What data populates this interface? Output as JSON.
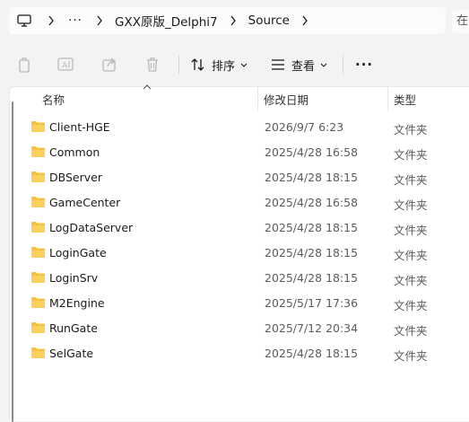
{
  "address_bar": {
    "ellipsis": "···",
    "crumbs": [
      "GXX原版_Delphi7",
      "Source"
    ],
    "right_edge_text": "在"
  },
  "toolbar": {
    "sort_label": "排序",
    "view_label": "查看",
    "more_label": "···"
  },
  "columns": {
    "name": "名称",
    "modified": "修改日期",
    "type": "类型"
  },
  "files": [
    {
      "name": "Client-HGE",
      "modified": "2026/9/7 6:23",
      "type": "文件夹"
    },
    {
      "name": "Common",
      "modified": "2025/4/28 16:58",
      "type": "文件夹"
    },
    {
      "name": "DBServer",
      "modified": "2025/4/28 18:15",
      "type": "文件夹"
    },
    {
      "name": "GameCenter",
      "modified": "2025/4/28 16:58",
      "type": "文件夹"
    },
    {
      "name": "LogDataServer",
      "modified": "2025/4/28 18:15",
      "type": "文件夹"
    },
    {
      "name": "LoginGate",
      "modified": "2025/4/28 18:15",
      "type": "文件夹"
    },
    {
      "name": "LoginSrv",
      "modified": "2025/4/28 18:15",
      "type": "文件夹"
    },
    {
      "name": "M2Engine",
      "modified": "2025/5/17 17:36",
      "type": "文件夹"
    },
    {
      "name": "RunGate",
      "modified": "2025/7/12 20:34",
      "type": "文件夹"
    },
    {
      "name": "SelGate",
      "modified": "2025/4/28 18:15",
      "type": "文件夹"
    }
  ],
  "colors": {
    "folder_yellow": "#f5c242",
    "background": "#f3f3f3",
    "panel": "#ffffff"
  },
  "icons": {
    "computer": "computer-icon",
    "copy": "copy-icon",
    "rename": "rename-icon",
    "share": "share-icon",
    "delete": "delete-icon",
    "sort": "sort-icon",
    "view": "view-icon",
    "folder": "folder-icon"
  }
}
